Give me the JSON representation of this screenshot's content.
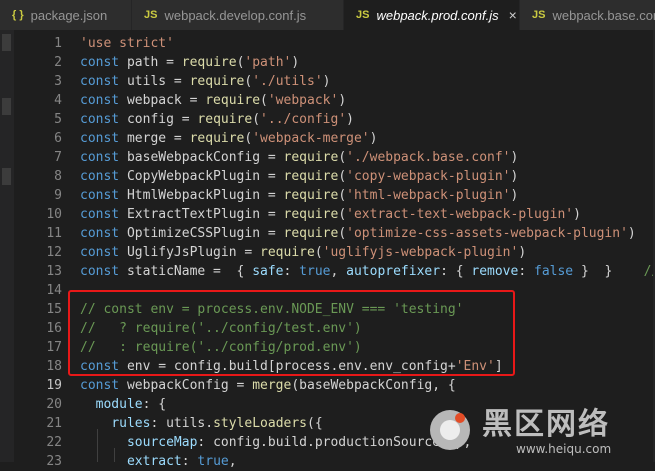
{
  "tabs": [
    {
      "icon": "{ }",
      "label": "package.json"
    },
    {
      "icon": "JS",
      "label": "webpack.develop.conf.js"
    },
    {
      "icon": "JS",
      "label": "webpack.prod.conf.js",
      "close": "×"
    },
    {
      "icon": "JS",
      "label": "webpack.base.conf.js"
    }
  ],
  "lines": [
    {
      "num": "1",
      "tokens": [
        [
          "s",
          "'use strict'"
        ]
      ]
    },
    {
      "num": "2",
      "tokens": [
        [
          "k",
          "const"
        ],
        [
          "t",
          " path = "
        ],
        [
          "f",
          "require"
        ],
        [
          "t",
          "("
        ],
        [
          "s",
          "'path'"
        ],
        [
          "t",
          ")"
        ]
      ]
    },
    {
      "num": "3",
      "tokens": [
        [
          "k",
          "const"
        ],
        [
          "t",
          " utils = "
        ],
        [
          "f",
          "require"
        ],
        [
          "t",
          "("
        ],
        [
          "s",
          "'./utils'"
        ],
        [
          "t",
          ")"
        ]
      ]
    },
    {
      "num": "4",
      "tokens": [
        [
          "k",
          "const"
        ],
        [
          "t",
          " webpack = "
        ],
        [
          "f",
          "require"
        ],
        [
          "t",
          "("
        ],
        [
          "s",
          "'webpack'"
        ],
        [
          "t",
          ")"
        ]
      ]
    },
    {
      "num": "5",
      "tokens": [
        [
          "k",
          "const"
        ],
        [
          "t",
          " config = "
        ],
        [
          "f",
          "require"
        ],
        [
          "t",
          "("
        ],
        [
          "s",
          "'../config'"
        ],
        [
          "t",
          ")"
        ]
      ]
    },
    {
      "num": "6",
      "tokens": [
        [
          "k",
          "const"
        ],
        [
          "t",
          " merge = "
        ],
        [
          "f",
          "require"
        ],
        [
          "t",
          "("
        ],
        [
          "s",
          "'webpack-merge'"
        ],
        [
          "t",
          ")"
        ]
      ]
    },
    {
      "num": "7",
      "tokens": [
        [
          "k",
          "const"
        ],
        [
          "t",
          " baseWebpackConfig = "
        ],
        [
          "f",
          "require"
        ],
        [
          "t",
          "("
        ],
        [
          "s",
          "'./webpack.base.conf'"
        ],
        [
          "t",
          ")"
        ]
      ]
    },
    {
      "num": "8",
      "tokens": [
        [
          "k",
          "const"
        ],
        [
          "t",
          " CopyWebpackPlugin = "
        ],
        [
          "f",
          "require"
        ],
        [
          "t",
          "("
        ],
        [
          "s",
          "'copy-webpack-plugin'"
        ],
        [
          "t",
          ")"
        ]
      ]
    },
    {
      "num": "9",
      "tokens": [
        [
          "k",
          "const"
        ],
        [
          "t",
          " HtmlWebpackPlugin = "
        ],
        [
          "f",
          "require"
        ],
        [
          "t",
          "("
        ],
        [
          "s",
          "'html-webpack-plugin'"
        ],
        [
          "t",
          ")"
        ]
      ]
    },
    {
      "num": "10",
      "tokens": [
        [
          "k",
          "const"
        ],
        [
          "t",
          " ExtractTextPlugin = "
        ],
        [
          "f",
          "require"
        ],
        [
          "t",
          "("
        ],
        [
          "s",
          "'extract-text-webpack-plugin'"
        ],
        [
          "t",
          ")"
        ]
      ]
    },
    {
      "num": "11",
      "tokens": [
        [
          "k",
          "const"
        ],
        [
          "t",
          " OptimizeCSSPlugin = "
        ],
        [
          "f",
          "require"
        ],
        [
          "t",
          "("
        ],
        [
          "s",
          "'optimize-css-assets-webpack-plugin'"
        ],
        [
          "t",
          ")"
        ]
      ]
    },
    {
      "num": "12",
      "tokens": [
        [
          "k",
          "const"
        ],
        [
          "t",
          " UglifyJsPlugin = "
        ],
        [
          "f",
          "require"
        ],
        [
          "t",
          "("
        ],
        [
          "s",
          "'uglifyjs-webpack-plugin'"
        ],
        [
          "t",
          ")"
        ]
      ]
    },
    {
      "num": "13",
      "tokens": [
        [
          "k",
          "const"
        ],
        [
          "t",
          " staticName =  { "
        ],
        [
          "v",
          "safe"
        ],
        [
          "t",
          ": "
        ],
        [
          "k",
          "true"
        ],
        [
          "t",
          ", "
        ],
        [
          "v",
          "autoprefixer"
        ],
        [
          "t",
          ": { "
        ],
        [
          "v",
          "remove"
        ],
        [
          "t",
          ": "
        ],
        [
          "k",
          "false"
        ],
        [
          "t",
          " }  }    "
        ],
        [
          "c",
          "//清"
        ]
      ]
    },
    {
      "num": "14",
      "tokens": []
    },
    {
      "num": "15",
      "tokens": [
        [
          "c",
          "// const env = process.env.NODE_ENV === 'testing'"
        ]
      ]
    },
    {
      "num": "16",
      "tokens": [
        [
          "c",
          "//   ? require('../config/test.env')"
        ]
      ]
    },
    {
      "num": "17",
      "tokens": [
        [
          "c",
          "//   : require('../config/prod.env')"
        ]
      ]
    },
    {
      "num": "18",
      "tokens": [
        [
          "k",
          "const"
        ],
        [
          "t",
          " env = config.build[process.env.env_config+"
        ],
        [
          "s",
          "'Env'"
        ],
        [
          "t",
          "]"
        ]
      ]
    },
    {
      "num": "19",
      "current": true,
      "tokens": [
        [
          "k",
          "const"
        ],
        [
          "t",
          " webpackConfig = "
        ],
        [
          "f",
          "merge"
        ],
        [
          "t",
          "(baseWebpackConfig, {"
        ]
      ]
    },
    {
      "num": "20",
      "tokens": [
        [
          "t",
          "  "
        ],
        [
          "v",
          "module"
        ],
        [
          "t",
          ": {"
        ]
      ]
    },
    {
      "num": "21",
      "tokens": [
        [
          "t",
          "    "
        ],
        [
          "v",
          "rules"
        ],
        [
          "t",
          ": utils."
        ],
        [
          "f",
          "styleLoaders"
        ],
        [
          "t",
          "({"
        ]
      ]
    },
    {
      "num": "22",
      "tokens": [
        [
          "t",
          "      "
        ],
        [
          "v",
          "sourceMap"
        ],
        [
          "t",
          ": config.build.productionSourceMap,"
        ]
      ]
    },
    {
      "num": "23",
      "tokens": [
        [
          "t",
          "      "
        ],
        [
          "v",
          "extract"
        ],
        [
          "t",
          ": "
        ],
        [
          "k",
          "true"
        ],
        [
          "t",
          ","
        ]
      ]
    }
  ],
  "watermark": {
    "title": "黑区网络",
    "subtitle": "www.heiqu.com"
  }
}
